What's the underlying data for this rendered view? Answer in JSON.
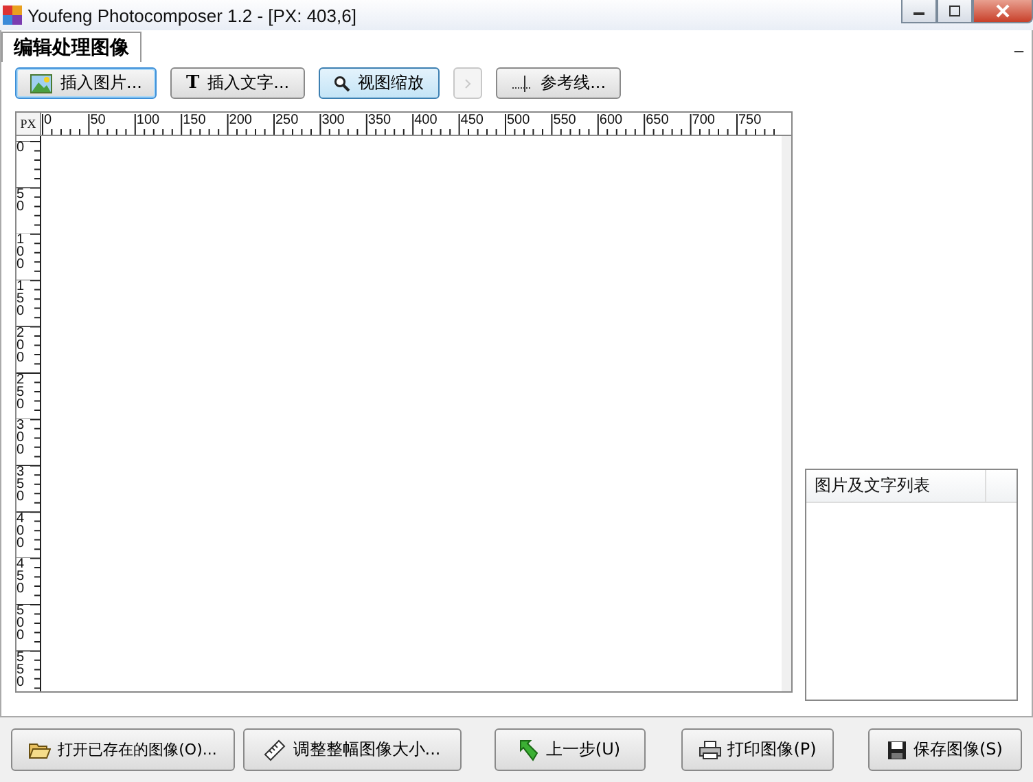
{
  "window": {
    "title": "Youfeng Photocomposer 1.2 - [PX: 403,6]"
  },
  "tabs": [
    {
      "label": "编辑处理图像",
      "selected": true
    }
  ],
  "minimize_panel": "_",
  "toolbar": [
    {
      "label": "插入图片...",
      "focused": true,
      "pressed": false,
      "disabled": false
    },
    {
      "label": "插入文字...",
      "glyph": "T",
      "focused": false,
      "pressed": false,
      "disabled": false
    },
    {
      "label": "视图缩放",
      "focused": false,
      "pressed": true,
      "disabled": false
    },
    {
      "focused": false,
      "pressed": false,
      "disabled": true
    },
    {
      "label": "参考线...",
      "focused": false,
      "pressed": false,
      "disabled": false
    }
  ],
  "ruler": {
    "unit": "PX",
    "x_labels": [
      "0",
      "50",
      "100",
      "150",
      "200",
      "250",
      "300",
      "350",
      "400",
      "450",
      "500",
      "550",
      "600",
      "650",
      "700",
      "750"
    ],
    "y_labels": [
      "0",
      "50",
      "100",
      "150",
      "200",
      "250",
      "300",
      "350",
      "400",
      "450",
      "500",
      "550"
    ]
  },
  "list_panel": {
    "columns": [
      "图片及文字列表"
    ]
  },
  "bottom_buttons": [
    {
      "label": "打开已存在的图像(O)..."
    },
    {
      "label": "调整整幅图像大小..."
    },
    {
      "label": "上一步(U)"
    },
    {
      "label": "打印图像(P)"
    },
    {
      "label": "保存图像(S)"
    }
  ]
}
